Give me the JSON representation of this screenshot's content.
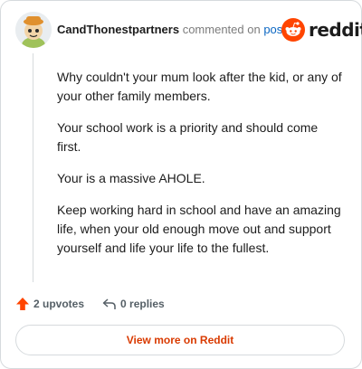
{
  "header": {
    "author": "CandThonestpartners",
    "verb": "commented on",
    "link_label": "post",
    "brand": "reddit"
  },
  "comment": {
    "paragraphs": [
      "Why couldn't your mum look after the kid, or any of your other family members.",
      "Your school work is a priority and should come first.",
      "Your is a massive AHOLE.",
      "Keep working hard in school and have an amazing life, when your old enough move out and support yourself and life your life to the fullest."
    ]
  },
  "actions": {
    "upvotes": "2 upvotes",
    "replies": "0 replies"
  },
  "view_more": "View more on Reddit",
  "colors": {
    "accent": "#ff4500",
    "link": "#0a66c2",
    "view_more": "#d93a00"
  },
  "icons": {
    "avatar": "avatar-icon",
    "brand": "reddit-snoo-icon",
    "upvote": "upvote-arrow-icon",
    "reply": "reply-arrow-icon"
  }
}
